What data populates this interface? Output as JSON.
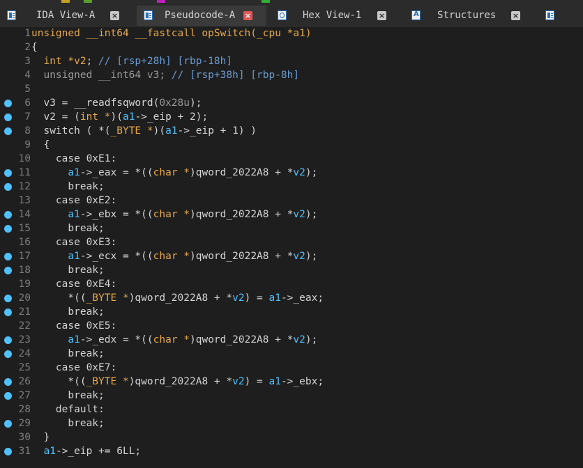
{
  "tabs": [
    {
      "label": "IDA View-A",
      "icon": "ida-view-icon",
      "active": false
    },
    {
      "label": "Pseudocode-A",
      "icon": "pseudocode-icon",
      "active": true
    },
    {
      "label": "Hex View-1",
      "icon": "hex-view-icon",
      "active": false
    },
    {
      "label": "Structures",
      "icon": "structures-icon",
      "active": false
    }
  ],
  "close_glyph": "×",
  "colors": {
    "background": "#1e1e1e",
    "keyword": "#e5a84a",
    "variable": "#4fc1ff",
    "comment": "#6b9bd1",
    "breakpoint": "#4fc1ff",
    "active_tab_close": "#e05555"
  },
  "code_lines": [
    {
      "num": "1",
      "bp": false,
      "segs": [
        [
          "kw",
          "unsigned __int64 __fastcall opSwitch(_cpu *a1)"
        ]
      ]
    },
    {
      "num": "2",
      "bp": false,
      "segs": [
        [
          "tx",
          "{"
        ]
      ]
    },
    {
      "num": "3",
      "bp": false,
      "segs": [
        [
          "tx",
          "  "
        ],
        [
          "kw",
          "int *v2"
        ],
        [
          "tx",
          "; "
        ],
        [
          "cm",
          "// [rsp+28h] [rbp-18h]"
        ]
      ]
    },
    {
      "num": "4",
      "bp": false,
      "segs": [
        [
          "gr",
          "  unsigned __int64 v3; "
        ],
        [
          "cm",
          "// [rsp+38h] [rbp-8h]"
        ]
      ]
    },
    {
      "num": "5",
      "bp": false,
      "segs": []
    },
    {
      "num": "6",
      "bp": true,
      "segs": [
        [
          "tx",
          "  v3 = __readfsqword("
        ],
        [
          "gr",
          "0x28u"
        ],
        [
          "tx",
          ");"
        ]
      ]
    },
    {
      "num": "7",
      "bp": true,
      "segs": [
        [
          "tx",
          "  v2 = ("
        ],
        [
          "kw",
          "int *"
        ],
        [
          "tx",
          ")("
        ],
        [
          "vr",
          "a1"
        ],
        [
          "tx",
          "->_eip + 2);"
        ]
      ]
    },
    {
      "num": "8",
      "bp": true,
      "segs": [
        [
          "tx",
          "  switch ( *("
        ],
        [
          "kw",
          "_BYTE *"
        ],
        [
          "tx",
          ")("
        ],
        [
          "vr",
          "a1"
        ],
        [
          "tx",
          "->_eip + 1) )"
        ]
      ]
    },
    {
      "num": "9",
      "bp": false,
      "segs": [
        [
          "tx",
          "  {"
        ]
      ]
    },
    {
      "num": "10",
      "bp": false,
      "segs": [
        [
          "tx",
          "    case 0xE1:"
        ]
      ]
    },
    {
      "num": "11",
      "bp": true,
      "segs": [
        [
          "tx",
          "      "
        ],
        [
          "vr",
          "a1"
        ],
        [
          "tx",
          "->_eax = *(("
        ],
        [
          "kw",
          "char *"
        ],
        [
          "tx",
          ")qword_2022A8 + *"
        ],
        [
          "vr",
          "v2"
        ],
        [
          "tx",
          ");"
        ]
      ]
    },
    {
      "num": "12",
      "bp": true,
      "segs": [
        [
          "tx",
          "      break;"
        ]
      ]
    },
    {
      "num": "13",
      "bp": false,
      "segs": [
        [
          "tx",
          "    case 0xE2:"
        ]
      ]
    },
    {
      "num": "14",
      "bp": true,
      "segs": [
        [
          "tx",
          "      "
        ],
        [
          "vr",
          "a1"
        ],
        [
          "tx",
          "->_ebx = *(("
        ],
        [
          "kw",
          "char *"
        ],
        [
          "tx",
          ")qword_2022A8 + *"
        ],
        [
          "vr",
          "v2"
        ],
        [
          "tx",
          ");"
        ]
      ]
    },
    {
      "num": "15",
      "bp": true,
      "segs": [
        [
          "tx",
          "      break;"
        ]
      ]
    },
    {
      "num": "16",
      "bp": false,
      "segs": [
        [
          "tx",
          "    case 0xE3:"
        ]
      ]
    },
    {
      "num": "17",
      "bp": true,
      "segs": [
        [
          "tx",
          "      "
        ],
        [
          "vr",
          "a1"
        ],
        [
          "tx",
          "->_ecx = *(("
        ],
        [
          "kw",
          "char *"
        ],
        [
          "tx",
          ")qword_2022A8 + *"
        ],
        [
          "vr",
          "v2"
        ],
        [
          "tx",
          ");"
        ]
      ]
    },
    {
      "num": "18",
      "bp": true,
      "segs": [
        [
          "tx",
          "      break;"
        ]
      ]
    },
    {
      "num": "19",
      "bp": false,
      "segs": [
        [
          "tx",
          "    case 0xE4:"
        ]
      ]
    },
    {
      "num": "20",
      "bp": true,
      "segs": [
        [
          "tx",
          "      *(("
        ],
        [
          "kw",
          "_BYTE *"
        ],
        [
          "tx",
          ")qword_2022A8 + *"
        ],
        [
          "vr",
          "v2"
        ],
        [
          "tx",
          ") = "
        ],
        [
          "vr",
          "a1"
        ],
        [
          "tx",
          "->_eax;"
        ]
      ]
    },
    {
      "num": "21",
      "bp": true,
      "segs": [
        [
          "tx",
          "      break;"
        ]
      ]
    },
    {
      "num": "22",
      "bp": false,
      "segs": [
        [
          "tx",
          "    case 0xE5:"
        ]
      ]
    },
    {
      "num": "23",
      "bp": true,
      "segs": [
        [
          "tx",
          "      "
        ],
        [
          "vr",
          "a1"
        ],
        [
          "tx",
          "->_edx = *(("
        ],
        [
          "kw",
          "char *"
        ],
        [
          "tx",
          ")qword_2022A8 + *"
        ],
        [
          "vr",
          "v2"
        ],
        [
          "tx",
          ");"
        ]
      ]
    },
    {
      "num": "24",
      "bp": true,
      "segs": [
        [
          "tx",
          "      break;"
        ]
      ]
    },
    {
      "num": "25",
      "bp": false,
      "segs": [
        [
          "tx",
          "    case 0xE7:"
        ]
      ]
    },
    {
      "num": "26",
      "bp": true,
      "segs": [
        [
          "tx",
          "      *(("
        ],
        [
          "kw",
          "_BYTE *"
        ],
        [
          "tx",
          ")qword_2022A8 + *"
        ],
        [
          "vr",
          "v2"
        ],
        [
          "tx",
          ") = "
        ],
        [
          "vr",
          "a1"
        ],
        [
          "tx",
          "->_ebx;"
        ]
      ]
    },
    {
      "num": "27",
      "bp": true,
      "segs": [
        [
          "tx",
          "      break;"
        ]
      ]
    },
    {
      "num": "28",
      "bp": false,
      "segs": [
        [
          "tx",
          "    default:"
        ]
      ]
    },
    {
      "num": "29",
      "bp": true,
      "segs": [
        [
          "tx",
          "      break;"
        ]
      ]
    },
    {
      "num": "30",
      "bp": false,
      "segs": [
        [
          "tx",
          "  }"
        ]
      ]
    },
    {
      "num": "31",
      "bp": true,
      "segs": [
        [
          "tx",
          "  "
        ],
        [
          "vr",
          "a1"
        ],
        [
          "tx",
          "->_eip += 6LL;"
        ]
      ]
    }
  ]
}
